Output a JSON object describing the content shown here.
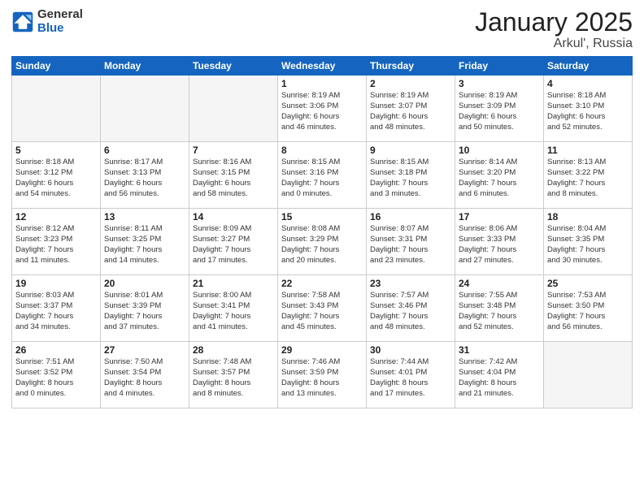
{
  "logo": {
    "general": "General",
    "blue": "Blue"
  },
  "header": {
    "month": "January 2025",
    "location": "Arkul', Russia"
  },
  "weekdays": [
    "Sunday",
    "Monday",
    "Tuesday",
    "Wednesday",
    "Thursday",
    "Friday",
    "Saturday"
  ],
  "weeks": [
    [
      {
        "day": "",
        "info": ""
      },
      {
        "day": "",
        "info": ""
      },
      {
        "day": "",
        "info": ""
      },
      {
        "day": "1",
        "info": "Sunrise: 8:19 AM\nSunset: 3:06 PM\nDaylight: 6 hours\nand 46 minutes."
      },
      {
        "day": "2",
        "info": "Sunrise: 8:19 AM\nSunset: 3:07 PM\nDaylight: 6 hours\nand 48 minutes."
      },
      {
        "day": "3",
        "info": "Sunrise: 8:19 AM\nSunset: 3:09 PM\nDaylight: 6 hours\nand 50 minutes."
      },
      {
        "day": "4",
        "info": "Sunrise: 8:18 AM\nSunset: 3:10 PM\nDaylight: 6 hours\nand 52 minutes."
      }
    ],
    [
      {
        "day": "5",
        "info": "Sunrise: 8:18 AM\nSunset: 3:12 PM\nDaylight: 6 hours\nand 54 minutes."
      },
      {
        "day": "6",
        "info": "Sunrise: 8:17 AM\nSunset: 3:13 PM\nDaylight: 6 hours\nand 56 minutes."
      },
      {
        "day": "7",
        "info": "Sunrise: 8:16 AM\nSunset: 3:15 PM\nDaylight: 6 hours\nand 58 minutes."
      },
      {
        "day": "8",
        "info": "Sunrise: 8:15 AM\nSunset: 3:16 PM\nDaylight: 7 hours\nand 0 minutes."
      },
      {
        "day": "9",
        "info": "Sunrise: 8:15 AM\nSunset: 3:18 PM\nDaylight: 7 hours\nand 3 minutes."
      },
      {
        "day": "10",
        "info": "Sunrise: 8:14 AM\nSunset: 3:20 PM\nDaylight: 7 hours\nand 6 minutes."
      },
      {
        "day": "11",
        "info": "Sunrise: 8:13 AM\nSunset: 3:22 PM\nDaylight: 7 hours\nand 8 minutes."
      }
    ],
    [
      {
        "day": "12",
        "info": "Sunrise: 8:12 AM\nSunset: 3:23 PM\nDaylight: 7 hours\nand 11 minutes."
      },
      {
        "day": "13",
        "info": "Sunrise: 8:11 AM\nSunset: 3:25 PM\nDaylight: 7 hours\nand 14 minutes."
      },
      {
        "day": "14",
        "info": "Sunrise: 8:09 AM\nSunset: 3:27 PM\nDaylight: 7 hours\nand 17 minutes."
      },
      {
        "day": "15",
        "info": "Sunrise: 8:08 AM\nSunset: 3:29 PM\nDaylight: 7 hours\nand 20 minutes."
      },
      {
        "day": "16",
        "info": "Sunrise: 8:07 AM\nSunset: 3:31 PM\nDaylight: 7 hours\nand 23 minutes."
      },
      {
        "day": "17",
        "info": "Sunrise: 8:06 AM\nSunset: 3:33 PM\nDaylight: 7 hours\nand 27 minutes."
      },
      {
        "day": "18",
        "info": "Sunrise: 8:04 AM\nSunset: 3:35 PM\nDaylight: 7 hours\nand 30 minutes."
      }
    ],
    [
      {
        "day": "19",
        "info": "Sunrise: 8:03 AM\nSunset: 3:37 PM\nDaylight: 7 hours\nand 34 minutes."
      },
      {
        "day": "20",
        "info": "Sunrise: 8:01 AM\nSunset: 3:39 PM\nDaylight: 7 hours\nand 37 minutes."
      },
      {
        "day": "21",
        "info": "Sunrise: 8:00 AM\nSunset: 3:41 PM\nDaylight: 7 hours\nand 41 minutes."
      },
      {
        "day": "22",
        "info": "Sunrise: 7:58 AM\nSunset: 3:43 PM\nDaylight: 7 hours\nand 45 minutes."
      },
      {
        "day": "23",
        "info": "Sunrise: 7:57 AM\nSunset: 3:46 PM\nDaylight: 7 hours\nand 48 minutes."
      },
      {
        "day": "24",
        "info": "Sunrise: 7:55 AM\nSunset: 3:48 PM\nDaylight: 7 hours\nand 52 minutes."
      },
      {
        "day": "25",
        "info": "Sunrise: 7:53 AM\nSunset: 3:50 PM\nDaylight: 7 hours\nand 56 minutes."
      }
    ],
    [
      {
        "day": "26",
        "info": "Sunrise: 7:51 AM\nSunset: 3:52 PM\nDaylight: 8 hours\nand 0 minutes."
      },
      {
        "day": "27",
        "info": "Sunrise: 7:50 AM\nSunset: 3:54 PM\nDaylight: 8 hours\nand 4 minutes."
      },
      {
        "day": "28",
        "info": "Sunrise: 7:48 AM\nSunset: 3:57 PM\nDaylight: 8 hours\nand 8 minutes."
      },
      {
        "day": "29",
        "info": "Sunrise: 7:46 AM\nSunset: 3:59 PM\nDaylight: 8 hours\nand 13 minutes."
      },
      {
        "day": "30",
        "info": "Sunrise: 7:44 AM\nSunset: 4:01 PM\nDaylight: 8 hours\nand 17 minutes."
      },
      {
        "day": "31",
        "info": "Sunrise: 7:42 AM\nSunset: 4:04 PM\nDaylight: 8 hours\nand 21 minutes."
      },
      {
        "day": "",
        "info": ""
      }
    ]
  ]
}
